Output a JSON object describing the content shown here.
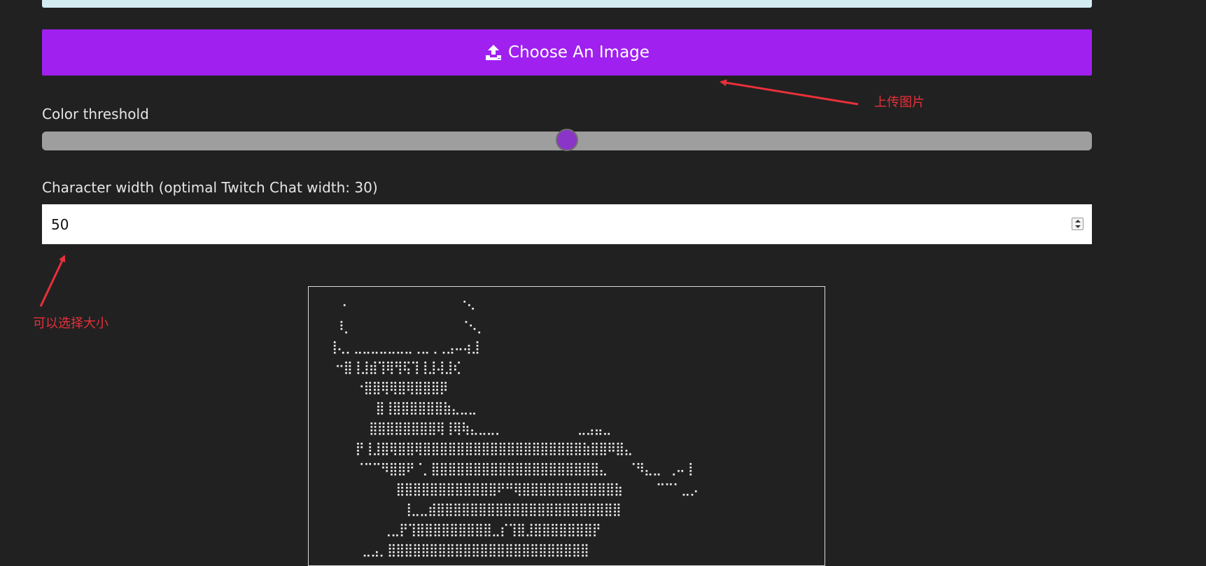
{
  "upload": {
    "label": "Choose An Image",
    "icon": "upload-icon"
  },
  "threshold": {
    "label": "Color threshold",
    "value_fraction": 0.5
  },
  "width_field": {
    "label": "Character width (optimal Twitch Chat width: 30)",
    "value": "50"
  },
  "ascii_output": [
    "  ⠂                ⠈⠢",
    " ⠸⡀                ⠈⠢⡀",
    "⢸⢄⡀⣀⣀⣀⣀⣀⣀⣀⢀⣀⢀⢀⣠⠤⢴⣸",
    " ⠒⣿⢸⣸⣾⢹⢿⢻⢯⢹⢸⣸⢼⣸⢎",
    "    ⠐⣿⣿⢿⢿⣿⢿⣿⣿⣿⡿",
    "       ⣿⢸⣿⣿⣿⣿⣿⣿⣷⣄⣀⣀",
    "      ⣿⣿⣿⣿⣿⣿⣿⣿⢿⢸⢿⢷⣄⣀⣀⡀           ⣀⣠⣤⣀",
    "    ⡟⢸⣸⣿⢿⣿⣿⢿⣿⣿⣿⣿⣿⣿⣿⣿⣿⣿⣿⣿⣿⣿⣿⣿⣿⣿⣿⣷⣿⣿⠿⣿⣄",
    "    ⠈⠉⠉⠻⣿⣿⠟⠈⡀⣿⣿⣿⣿⣿⣿⣿⣿⣿⣿⣿⣿⣿⣿⣿⣿⣿⣿⣿⣿⣄   ⠈⠻⣄⣀ ⢀⠤⢸",
    "          ⣿⣿⣿⣿⣿⣿⣿⣿⣿⣿⣿⣿⠟⠛⢿⣿⣿⣿⣿⣿⣿⣿⣿⣿⣿⣿⣷     ⠉⠉⠁⣀⡠",
    "           ⢸⣀⣀⣾⣿⣿⣿⣿⣿⣿⣿⣿⣿⣿⣿⣿⣿⣿⣿⣿⣿⣿⣿⣿⣿⣿",
    "        ⢀⣀⡟⢹⣿⣿⣿⣿⣿⣿⣿⣿⣿⣀⡎⢹⣿⣸⣿⣿⣿⣿⣿⣿⣿⡟",
    "     ⣀⣠⡀⣿⣿⣿⣿⣿⣿⣿⣿⣿⣿⣿⣿⣿⣿⣿⣿⣿⣿⣿⣿⣿⣿⣿⣿"
  ],
  "annotations": {
    "upload_note": "上传图片",
    "size_note": "可以选择大小"
  },
  "colors": {
    "accent": "#a020f0",
    "annotation": "#e8303a"
  }
}
